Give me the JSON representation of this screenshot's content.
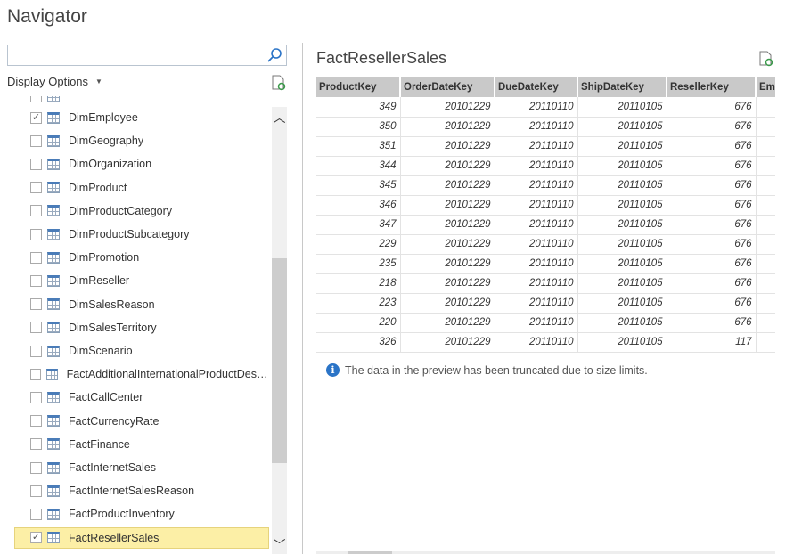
{
  "window": {
    "title": "Navigator"
  },
  "search": {
    "value": "",
    "placeholder": ""
  },
  "display_options": {
    "label": "Display Options"
  },
  "items": [
    {
      "label": "DimEmployee",
      "checked": true
    },
    {
      "label": "DimGeography",
      "checked": false
    },
    {
      "label": "DimOrganization",
      "checked": false
    },
    {
      "label": "DimProduct",
      "checked": false
    },
    {
      "label": "DimProductCategory",
      "checked": false
    },
    {
      "label": "DimProductSubcategory",
      "checked": false
    },
    {
      "label": "DimPromotion",
      "checked": false
    },
    {
      "label": "DimReseller",
      "checked": false
    },
    {
      "label": "DimSalesReason",
      "checked": false
    },
    {
      "label": "DimSalesTerritory",
      "checked": false
    },
    {
      "label": "DimScenario",
      "checked": false
    },
    {
      "label": "FactAdditionalInternationalProductDescription",
      "checked": false
    },
    {
      "label": "FactCallCenter",
      "checked": false
    },
    {
      "label": "FactCurrencyRate",
      "checked": false
    },
    {
      "label": "FactFinance",
      "checked": false
    },
    {
      "label": "FactInternetSales",
      "checked": false
    },
    {
      "label": "FactInternetSalesReason",
      "checked": false
    },
    {
      "label": "FactProductInventory",
      "checked": false
    },
    {
      "label": "FactResellerSales",
      "checked": true,
      "selected": true
    }
  ],
  "preview": {
    "title": "FactResellerSales",
    "columns": [
      "ProductKey",
      "OrderDateKey",
      "DueDateKey",
      "ShipDateKey",
      "ResellerKey",
      "EmployeeKey"
    ],
    "rows": [
      [
        "349",
        "20101229",
        "20110110",
        "20110105",
        "676",
        ""
      ],
      [
        "350",
        "20101229",
        "20110110",
        "20110105",
        "676",
        ""
      ],
      [
        "351",
        "20101229",
        "20110110",
        "20110105",
        "676",
        ""
      ],
      [
        "344",
        "20101229",
        "20110110",
        "20110105",
        "676",
        ""
      ],
      [
        "345",
        "20101229",
        "20110110",
        "20110105",
        "676",
        ""
      ],
      [
        "346",
        "20101229",
        "20110110",
        "20110105",
        "676",
        ""
      ],
      [
        "347",
        "20101229",
        "20110110",
        "20110105",
        "676",
        ""
      ],
      [
        "229",
        "20101229",
        "20110110",
        "20110105",
        "676",
        ""
      ],
      [
        "235",
        "20101229",
        "20110110",
        "20110105",
        "676",
        ""
      ],
      [
        "218",
        "20101229",
        "20110110",
        "20110105",
        "676",
        ""
      ],
      [
        "223",
        "20101229",
        "20110110",
        "20110105",
        "676",
        ""
      ],
      [
        "220",
        "20101229",
        "20110110",
        "20110105",
        "676",
        ""
      ],
      [
        "326",
        "20101229",
        "20110110",
        "20110105",
        "117",
        ""
      ]
    ],
    "info": "The data in the preview has been truncated due to size limits."
  },
  "colors": {
    "selected": "#fcefa6",
    "accent": "#2b74c7"
  }
}
